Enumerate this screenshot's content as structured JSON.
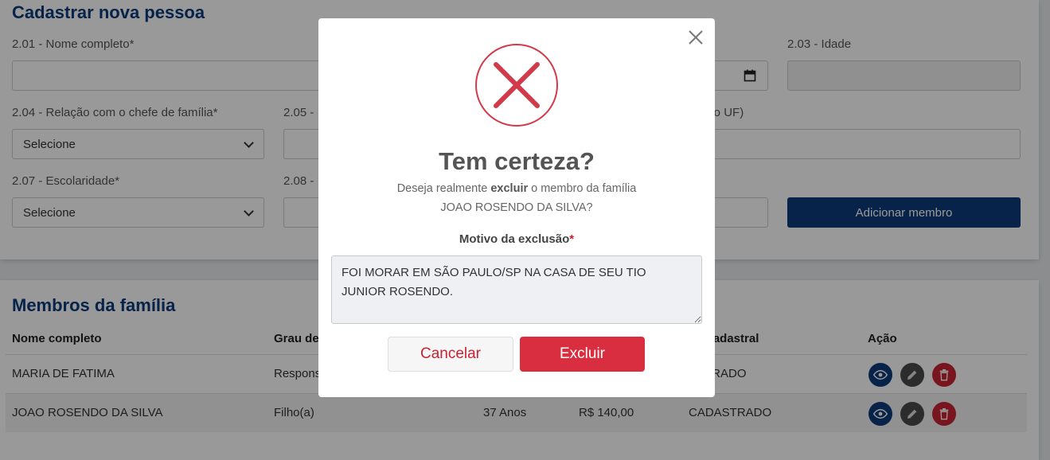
{
  "form": {
    "title": "Cadastrar nova pessoa",
    "fields": {
      "nome_label": "2.01 - Nome completo*",
      "idade_label": "2.03 - Idade",
      "relacao_label": "2.04 - Relação com o chefe de família*",
      "f205_label": "2.05 -",
      "uf_label": "gão UF)",
      "escolaridade_label": "2.07 - Escolaridade*",
      "f208_label": "2.08 -",
      "relacao_value": "Selecione",
      "escolaridade_value": "Selecione"
    },
    "add_button": "Adicionar membro"
  },
  "members": {
    "title": "Membros da família",
    "headers": {
      "nome": "Nome completo",
      "grau": "Grau de",
      "status": "do cadastral",
      "acao": "Ação"
    },
    "rows": [
      {
        "nome": "MARIA DE FATIMA",
        "grau": "Respons",
        "idade": "",
        "renda": "",
        "status": "ASTRADO"
      },
      {
        "nome": "JOAO ROSENDO DA SILVA",
        "grau": "Filho(a)",
        "idade": "37 Anos",
        "renda": "R$ 140,00",
        "status": "CADASTRADO"
      }
    ]
  },
  "modal": {
    "title": "Tem certeza?",
    "message_prefix": "Deseja realmente ",
    "message_bold": "excluir",
    "message_suffix": " o membro da família",
    "member_name": "JOAO ROSENDO DA SILVA?",
    "motivo_label": "Motivo da exclusão",
    "required_mark": "*",
    "motivo_value": "FOI MORAR EM SÃO PAULO/SP NA CASA DE SEU TIO JUNIOR ROSENDO.",
    "cancel_label": "Cancelar",
    "confirm_label": "Excluir"
  },
  "colors": {
    "primary": "#0d3b7a",
    "danger": "#d92e3f",
    "error_icon": "#d33a49"
  },
  "icons": [
    "close-icon",
    "error-x-icon",
    "calendar-icon",
    "chevron-down-icon",
    "eye-icon",
    "pencil-icon",
    "trash-icon"
  ]
}
